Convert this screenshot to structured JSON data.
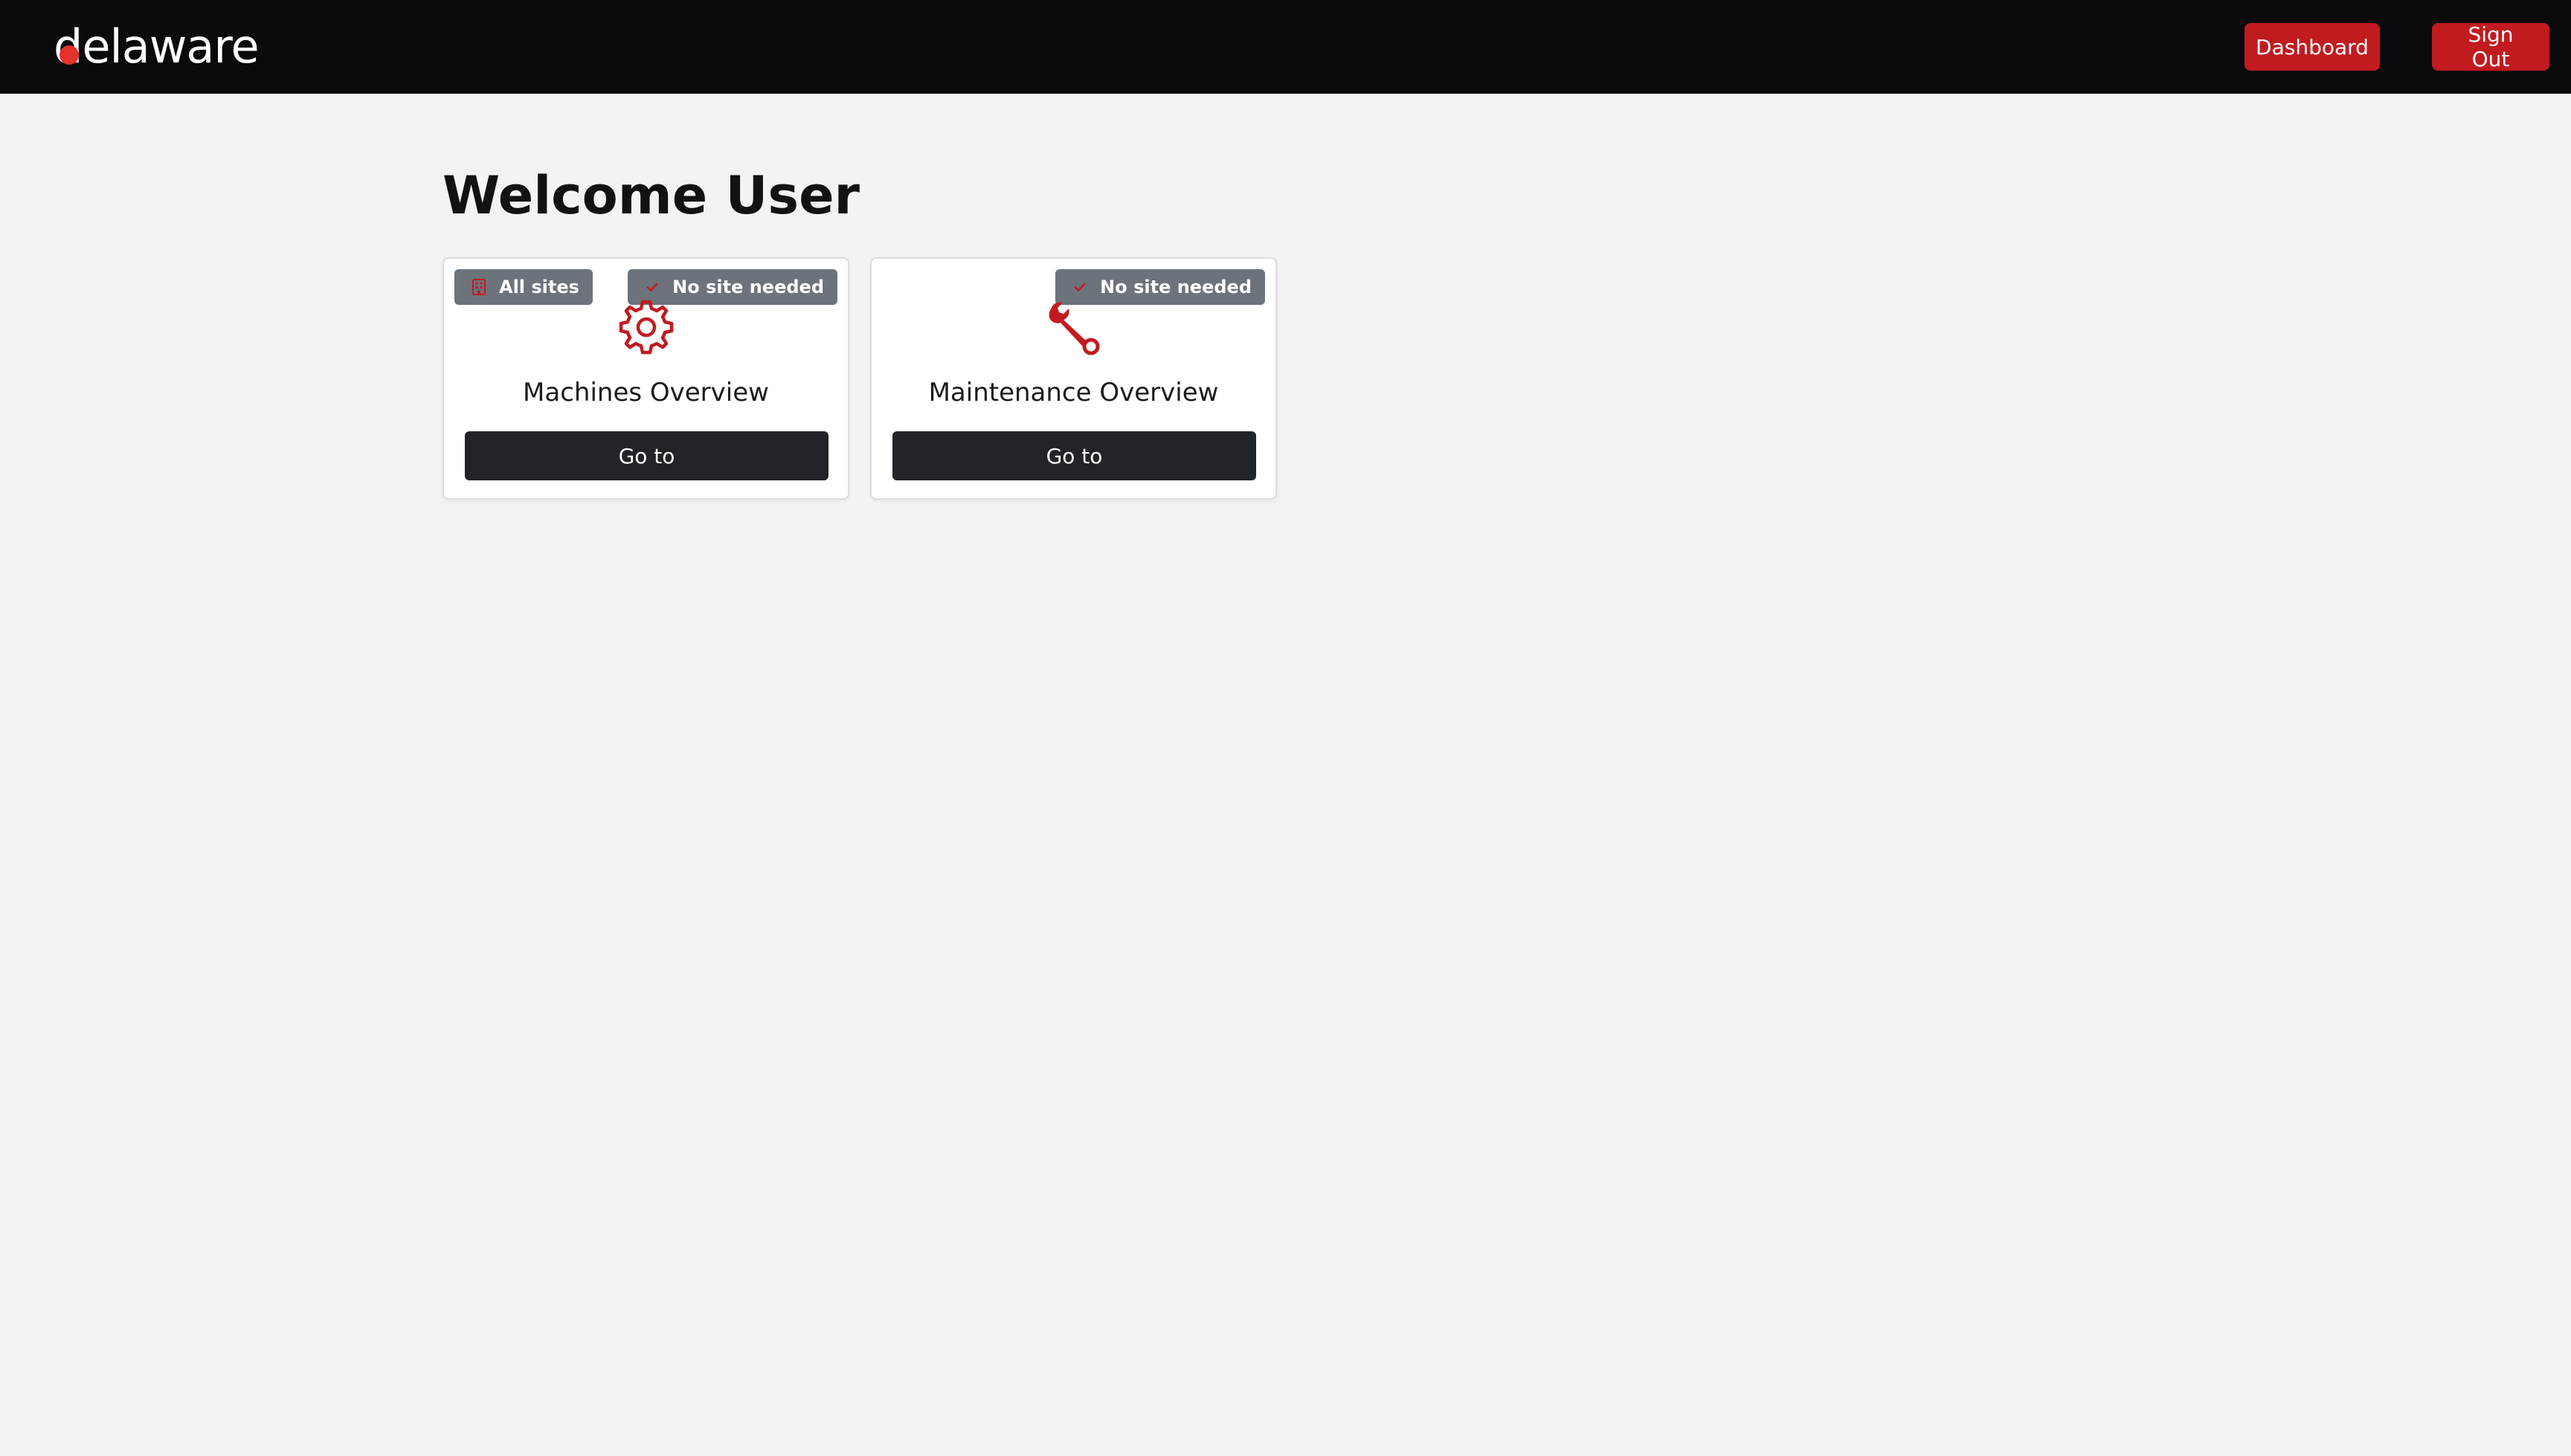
{
  "colors": {
    "navbar_bg": "#0a090b",
    "page_bg": "#f4f3f4",
    "accent_red": "#c11b20",
    "logo_dot": "#e4322b",
    "badge_bg": "#6c737b",
    "card_button_bg": "#212428"
  },
  "navbar": {
    "brand": "delaware",
    "dashboard_label": "Dashboard",
    "signout_label": "Sign Out"
  },
  "main": {
    "title": "Welcome User",
    "cards": [
      {
        "title": "Machines Overview",
        "icon": "gear-icon",
        "button_label": "Go to",
        "badges": [
          {
            "label": "All sites",
            "icon": "building-icon"
          },
          {
            "label": "No site needed",
            "icon": "check-icon"
          }
        ]
      },
      {
        "title": "Maintenance Overview",
        "icon": "wrench-icon",
        "button_label": "Go to",
        "badges": [
          {
            "label": "No site needed",
            "icon": "check-icon"
          }
        ]
      }
    ]
  }
}
